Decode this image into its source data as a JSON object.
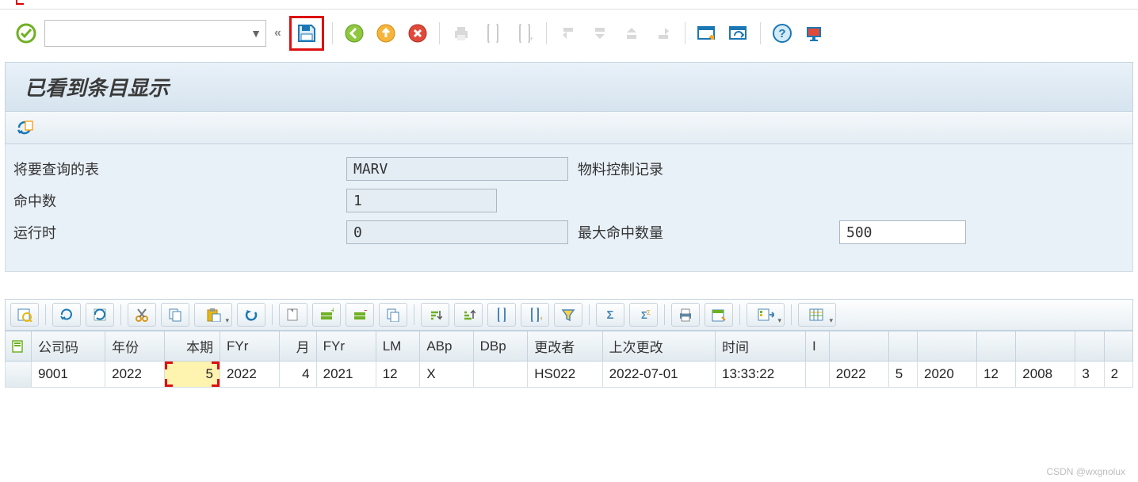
{
  "toolbar": {
    "command_value": "",
    "save_highlight": true
  },
  "title": "已看到条目显示",
  "form": {
    "table_label": "将要查询的表",
    "table_value": "MARV",
    "table_desc": "物料控制记录",
    "hits_label": "命中数",
    "hits_value": "1",
    "runtime_label": "运行时",
    "runtime_value": "0",
    "max_label": "最大命中数量",
    "max_value": "500"
  },
  "alv": {
    "headers": [
      "公司码",
      "年份",
      "本期",
      "FYr",
      "月",
      "FYr",
      "LM",
      "ABp",
      "DBp",
      "更改者",
      "上次更改",
      "时间",
      "I",
      "",
      "",
      "",
      "",
      "",
      "",
      ""
    ],
    "row": {
      "company": "9001",
      "year": "2022",
      "period": "5",
      "fyr1": "2022",
      "month": "4",
      "fyr2": "2021",
      "lm": "12",
      "abp": "X",
      "dbp": "",
      "changed_by": "HS022",
      "last_change": "2022-07-01",
      "time": "13:33:22",
      "i": "",
      "c14": "2022",
      "c15": "5",
      "c16": "2020",
      "c17": "12",
      "c18": "2008",
      "c19": "3",
      "c20": "2"
    }
  },
  "watermark": "CSDN @wxgnolux"
}
